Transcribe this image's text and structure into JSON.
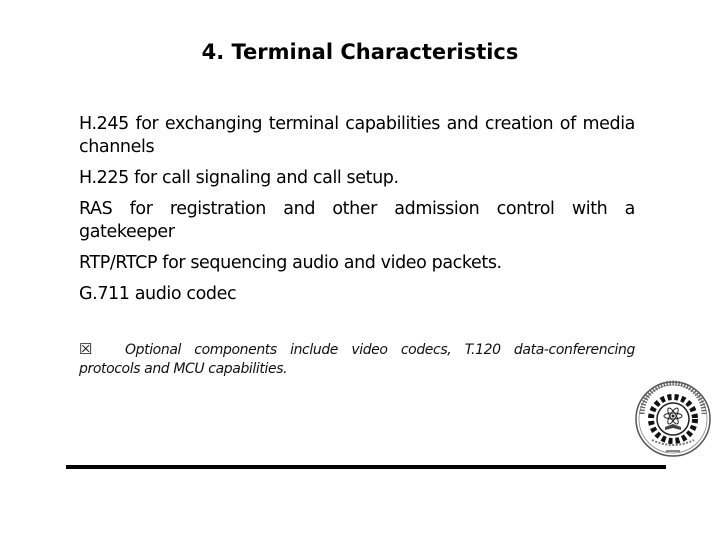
{
  "slide": {
    "title": "4.  Terminal Characteristics",
    "items": [
      "H.245 for exchanging terminal capabilities and creation of media channels",
      "H.225 for call signaling and call setup.",
      "RAS for registration and other admission control with a gatekeeper",
      "RTP/RTCP for sequencing audio and video packets.",
      "G.711 audio codec"
    ],
    "note": {
      "icon": "☒",
      "text": "Optional components include video codecs, T.120 data-conferencing protocols and MCU capabilities."
    },
    "logo": {
      "icon": "institute-seal-icon",
      "caption": "Birla Institute of Technology"
    }
  }
}
